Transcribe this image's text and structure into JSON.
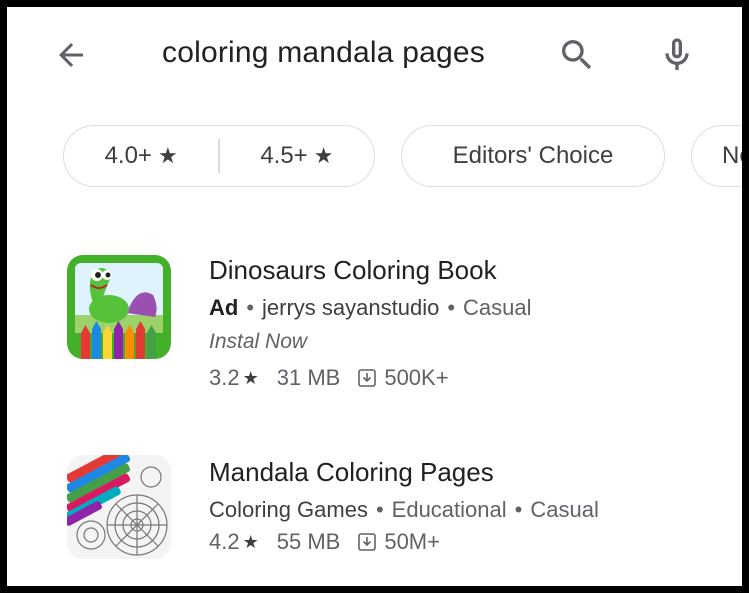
{
  "search": {
    "query": "coloring mandala pages"
  },
  "filters": {
    "rating_low": "4.0+",
    "rating_high": "4.5+",
    "editors_choice": "Editors' Choice",
    "partial": "Ne"
  },
  "apps": [
    {
      "title": "Dinosaurs Coloring Book",
      "ad_label": "Ad",
      "developer": "jerrys sayanstudio",
      "category": "Casual",
      "tagline": "Instal Now",
      "rating": "3.2",
      "size": "31 MB",
      "downloads": "500K+"
    },
    {
      "title": "Mandala Coloring Pages",
      "developer": "Coloring Games",
      "category": "Educational",
      "category2": "Casual",
      "rating": "4.2",
      "size": "55 MB",
      "downloads": "50M+"
    }
  ],
  "colors": {
    "text_primary": "#202124",
    "text_secondary": "#5f6368",
    "chip_border": "#dadce0"
  },
  "icons": {
    "back": "arrow-back-icon",
    "search": "search-icon",
    "mic": "mic-icon",
    "star": "star-icon",
    "download": "download-icon"
  }
}
